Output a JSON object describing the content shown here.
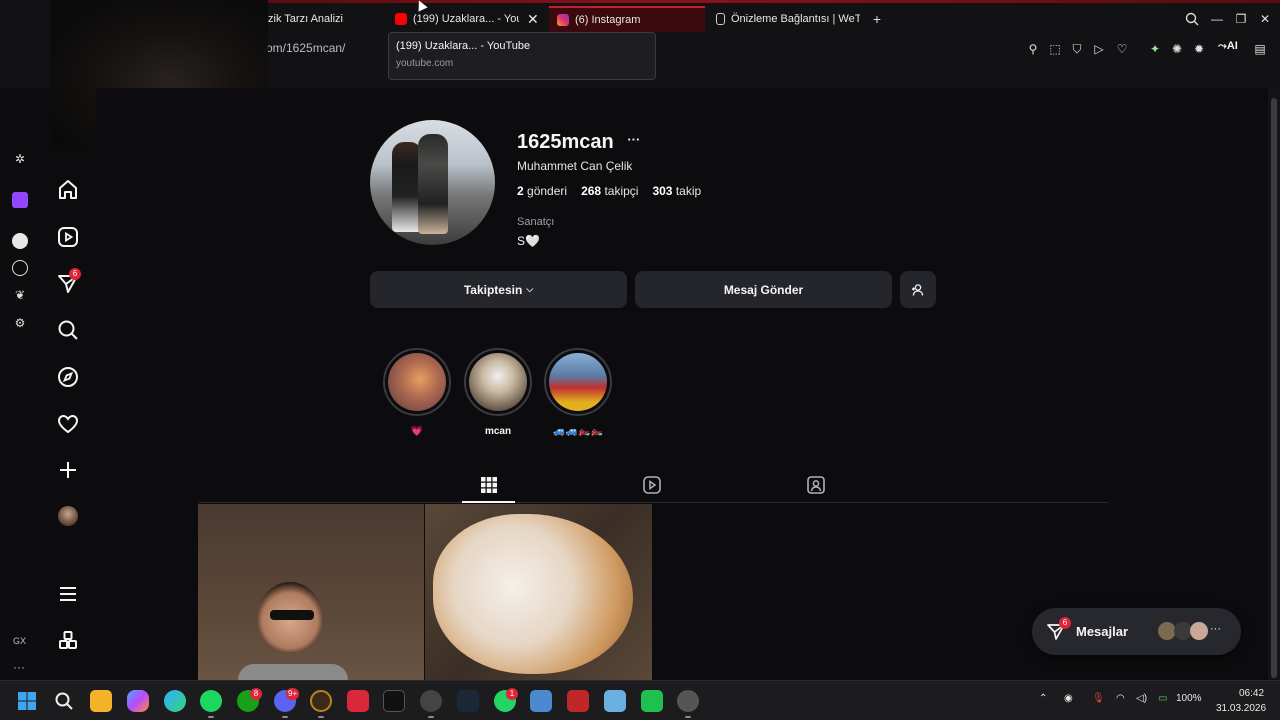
{
  "browser": {
    "tabs": [
      {
        "label": "zik Tarzı Analizi"
      },
      {
        "label": "(199) Uzaklara... - You"
      },
      {
        "label": "(6) Instagram"
      },
      {
        "label": "Önizleme Bağlantısı | WeTr"
      }
    ],
    "url": "om/1625mcan/",
    "tooltip": {
      "title": "(199) Uzaklara... - YouTube",
      "host": "youtube.com"
    },
    "ai_label": "AI"
  },
  "opera": {
    "gx_label": "GX"
  },
  "sidebar": {
    "notifications_badge": "6"
  },
  "profile": {
    "username": "1625mcan",
    "more": "···",
    "full_name": "Muhammet Can Çelik",
    "posts_count": "2",
    "posts_label": "gönderi",
    "followers_count": "268",
    "followers_label": "takipçi",
    "following_count": "303",
    "following_label": "takip",
    "category": "Sanatçı",
    "bio": "S🤍"
  },
  "actions": {
    "following": "Takiptesin",
    "message": "Mesaj Gönder"
  },
  "highlights": [
    {
      "label": "💗"
    },
    {
      "label": "mcan"
    },
    {
      "label": "🚙🚙🏍️🏍️"
    }
  ],
  "messages": {
    "label": "Mesajlar",
    "badge": "6"
  },
  "taskbar": {
    "badges": {
      "xbox": "8",
      "discord": "9+",
      "whatsapp": "1"
    },
    "battery": "100%",
    "time": "06:42",
    "date": "31.03.2026"
  }
}
